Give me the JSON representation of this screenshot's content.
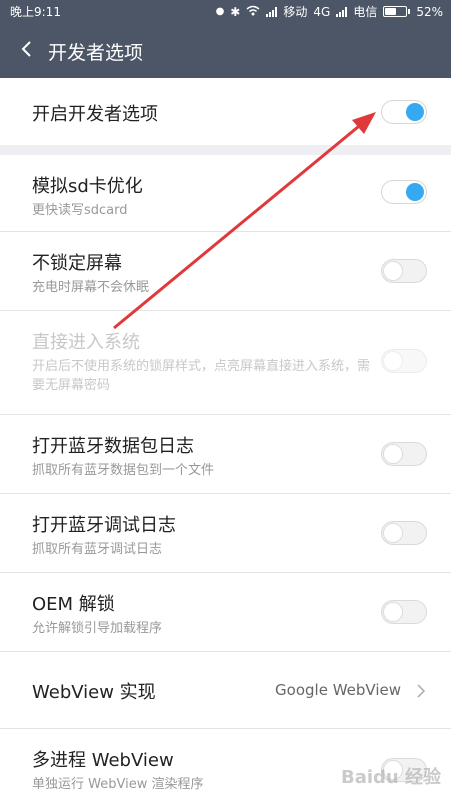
{
  "statusbar": {
    "time": "晚上9:11",
    "carrier1": "移动",
    "network": "4G",
    "carrier2": "电信",
    "battery": "52%",
    "battery_level": 0.52
  },
  "header": {
    "title": "开发者选项"
  },
  "master": {
    "label": "开启开发者选项",
    "on": true
  },
  "items": [
    {
      "title": "模拟sd卡优化",
      "subtitle": "更快读写sdcard",
      "state": "on"
    },
    {
      "title": "不锁定屏幕",
      "subtitle": "充电时屏幕不会休眠",
      "state": "off"
    },
    {
      "title": "直接进入系统",
      "subtitle": "开启后不使用系统的锁屏样式，点亮屏幕直接进入系统，需要无屏幕密码",
      "state": "disabled"
    },
    {
      "title": "打开蓝牙数据包日志",
      "subtitle": "抓取所有蓝牙数据包到一个文件",
      "state": "off"
    },
    {
      "title": "打开蓝牙调试日志",
      "subtitle": "抓取所有蓝牙调试日志",
      "state": "off"
    },
    {
      "title": "OEM 解锁",
      "subtitle": "允许解锁引导加载程序",
      "state": "off"
    },
    {
      "title": "WebView 实现",
      "value": "Google WebView"
    },
    {
      "title": "多进程 WebView",
      "subtitle": "单独运行 WebView 渲染程序",
      "state": "off"
    }
  ],
  "icons": {
    "back": "chevron-left-icon",
    "chevron": "chevron-right-icon",
    "bluetooth": "bluetooth-icon",
    "wifi": "wifi-icon",
    "signal": "signal-icon",
    "battery": "battery-icon"
  },
  "colors": {
    "header": "#4d5667",
    "accent": "#35a9f2",
    "annotation_arrow": "#e0393b"
  },
  "watermark": "Baidu 经验"
}
